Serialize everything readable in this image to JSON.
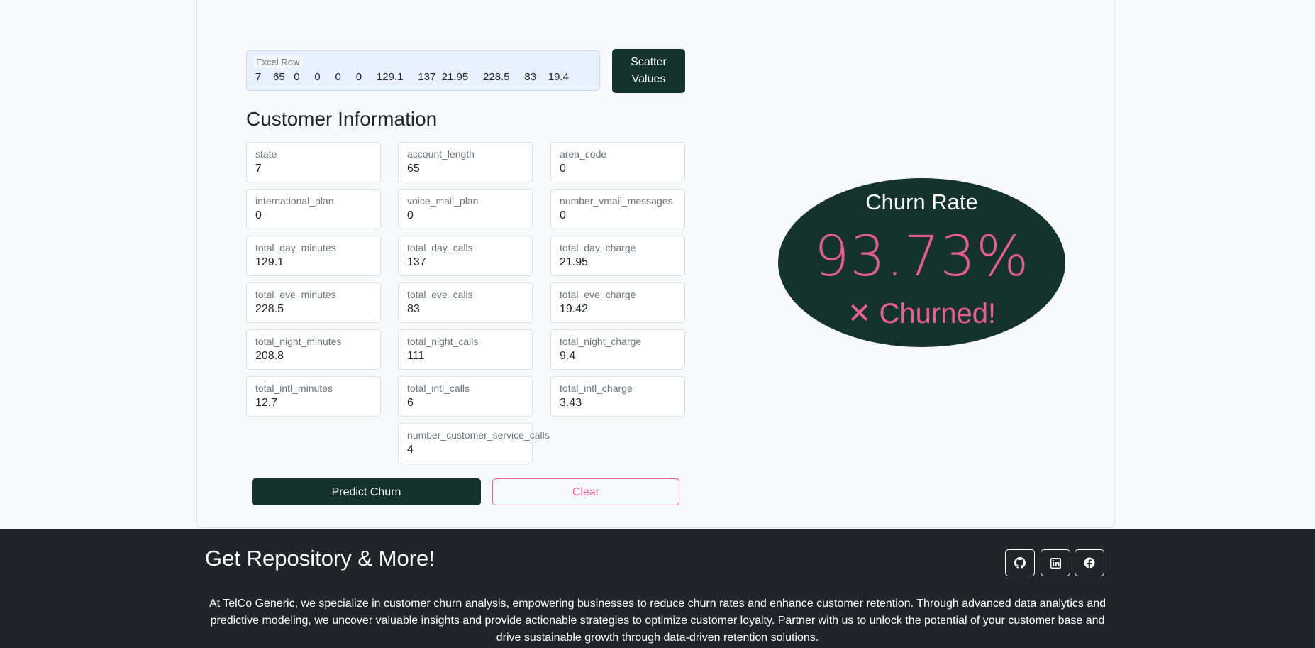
{
  "excel_row": {
    "label": "Excel Row",
    "values_text": "7    65   0     0     0     0     129.1     137  21.95     228.5     83    19.4"
  },
  "scatter_button": {
    "label": "Scatter Values"
  },
  "customer_info": {
    "title": "Customer Information",
    "fields": [
      {
        "label": "state",
        "value": "7"
      },
      {
        "label": "account_length",
        "value": "65"
      },
      {
        "label": "area_code",
        "value": "0"
      },
      {
        "label": "international_plan",
        "value": "0"
      },
      {
        "label": "voice_mail_plan",
        "value": "0"
      },
      {
        "label": "number_vmail_messages",
        "value": "0"
      },
      {
        "label": "total_day_minutes",
        "value": "129.1"
      },
      {
        "label": "total_day_calls",
        "value": "137"
      },
      {
        "label": "total_day_charge",
        "value": "21.95"
      },
      {
        "label": "total_eve_minutes",
        "value": "228.5"
      },
      {
        "label": "total_eve_calls",
        "value": "83"
      },
      {
        "label": "total_eve_charge",
        "value": "19.42"
      },
      {
        "label": "total_night_minutes",
        "value": "208.8"
      },
      {
        "label": "total_night_calls",
        "value": "111"
      },
      {
        "label": "total_night_charge",
        "value": "9.4"
      },
      {
        "label": "total_intl_minutes",
        "value": "12.7"
      },
      {
        "label": "total_intl_calls",
        "value": "6"
      },
      {
        "label": "total_intl_charge",
        "value": "3.43"
      },
      {
        "label": "number_customer_service_calls",
        "value": "4"
      }
    ]
  },
  "actions": {
    "predict_label": "Predict Churn",
    "clear_label": "Clear"
  },
  "churn": {
    "title": "Churn Rate",
    "rate": "93.73%",
    "status": "✕ Churned!",
    "colors": {
      "panel": "#14342b",
      "accent": "#ea5e96"
    }
  },
  "footer": {
    "title": "Get Repository & More!",
    "social": [
      {
        "icon": "github-icon"
      },
      {
        "icon": "linkedin-icon"
      },
      {
        "icon": "facebook-icon"
      }
    ],
    "description": "At TelCo Generic, we specialize in customer churn analysis, empowering businesses to reduce churn rates and enhance customer retention. Through advanced data analytics and predictive modeling, we uncover valuable insights and provide actionable strategies to optimize customer loyalty. Partner with us to unlock the potential of your customer base and drive sustainable growth through data-driven retention solutions."
  }
}
